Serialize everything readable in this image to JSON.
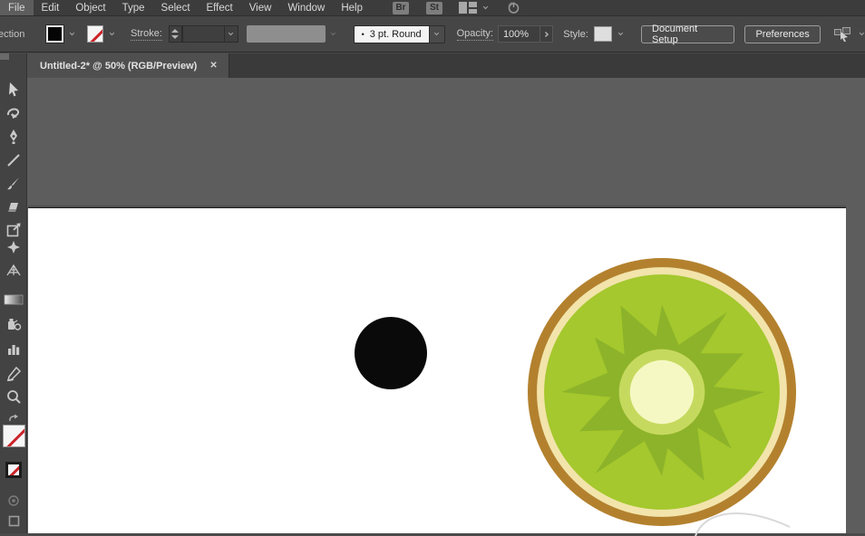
{
  "menubar": {
    "items": [
      "File",
      "Edit",
      "Object",
      "Type",
      "Select",
      "Effect",
      "View",
      "Window",
      "Help"
    ],
    "brushes_button": "Br",
    "styles_button": "St"
  },
  "controlbar": {
    "truncated_label": "ection",
    "stroke_label": "Stroke:",
    "brush_bullet": "•",
    "brush_value": "3 pt. Round",
    "opacity_label": "Opacity:",
    "opacity_value": "100%",
    "style_label": "Style:",
    "document_setup_label": "Document Setup",
    "preferences_label": "Preferences"
  },
  "tab": {
    "title": "Untitled-2* @ 50% (RGB/Preview)",
    "close_glyph": "✕"
  },
  "toolbar": {
    "icons": [
      "selection-tool",
      "curvature-tool",
      "pen-tool",
      "line-segment-tool",
      "paintbrush-tool",
      "eraser-tool",
      "artboard-tool",
      "shape-builder-tool",
      "perspective-grid-tool",
      "gradient-tool",
      "symbol-sprayer-tool",
      "column-graph-tool",
      "pencil-tool",
      "zoom-tool",
      "swap-fill-stroke",
      "fill-none-swatch",
      "stroke-none-swatch",
      "color-mode",
      "screen-mode"
    ]
  },
  "canvas": {
    "pasteboard_color": "#5d5d5d",
    "artboard_color": "#ffffff",
    "black_circle": {
      "color": "#0a0a0a"
    },
    "kiwi": {
      "skin_color": "#b3812e",
      "rind_color": "#f2e4ab",
      "flesh_color": "#a4c82d",
      "burst_color": "#8db32a",
      "core_ring_color": "#c6d95f",
      "core_color": "#f5f8c2"
    },
    "sketch_curve_color": "#d9d9d9"
  },
  "ui_colors": {
    "menubar_bg": "#3c3c3c",
    "controlbar_bg": "#464646",
    "tab_active_bg": "#4f4f4f",
    "toolbar_bg": "#434343",
    "none_slash_red": "#cc2229"
  }
}
